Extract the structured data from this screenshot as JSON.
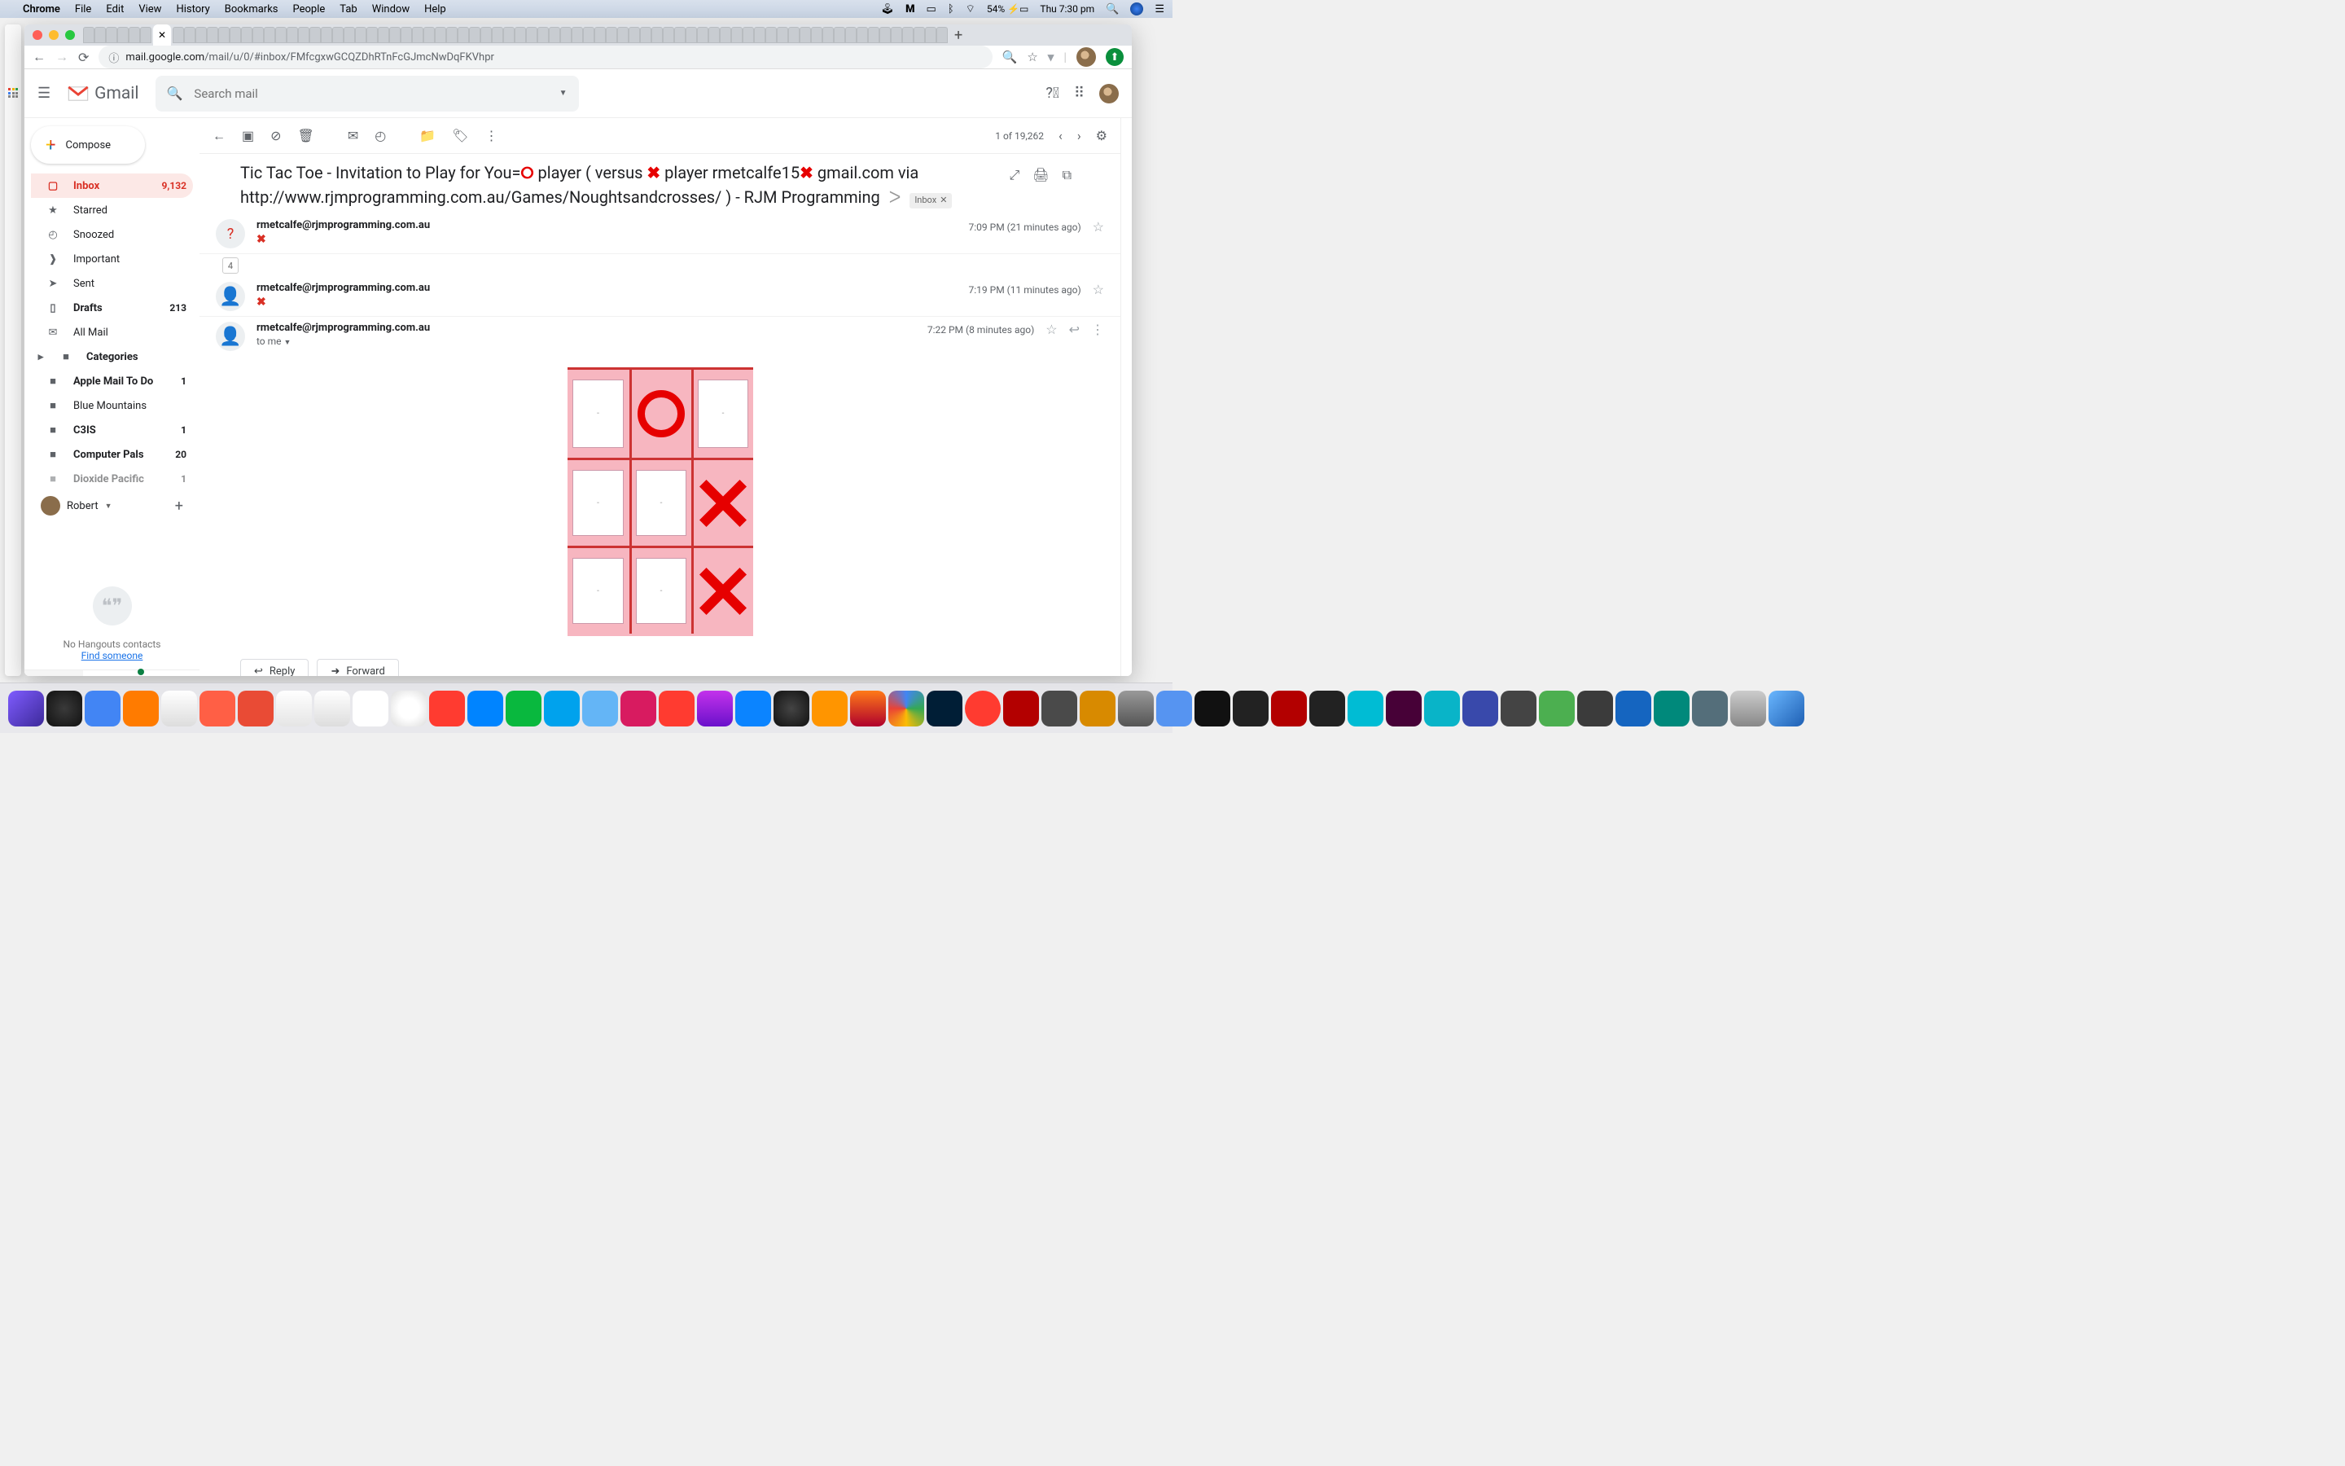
{
  "mac_menu": {
    "app": "Chrome",
    "items": [
      "File",
      "Edit",
      "View",
      "History",
      "Bookmarks",
      "People",
      "Tab",
      "Window",
      "Help"
    ],
    "battery": "54%",
    "clock": "Thu 7:30 pm"
  },
  "chrome": {
    "url_prefix": "mail.google.com",
    "url_rest": "/mail/u/0/#inbox/FMfcgxwGCQZDhRTnFcGJmcNwDqFKVhpr"
  },
  "gmail": {
    "brand": "Gmail",
    "search_placeholder": "Search mail",
    "compose": "Compose",
    "nav": [
      {
        "icon": "inbox",
        "label": "Inbox",
        "count": "9,132",
        "active": true
      },
      {
        "icon": "star",
        "label": "Starred"
      },
      {
        "icon": "clock",
        "label": "Snoozed"
      },
      {
        "icon": "important",
        "label": "Important"
      },
      {
        "icon": "send",
        "label": "Sent"
      },
      {
        "icon": "file",
        "label": "Drafts",
        "count": "213",
        "bold": true
      },
      {
        "icon": "mail",
        "label": "All Mail"
      },
      {
        "icon": "tag",
        "label": "Categories",
        "bold": true,
        "expand": true
      },
      {
        "icon": "tag",
        "label": "Apple Mail To Do",
        "count": "1",
        "bold": true
      },
      {
        "icon": "tag",
        "label": "Blue Mountains"
      },
      {
        "icon": "tag",
        "label": "C3IS",
        "count": "1",
        "bold": true
      },
      {
        "icon": "tag",
        "label": "Computer Pals",
        "count": "20",
        "bold": true
      },
      {
        "icon": "tag",
        "label": "Dioxide Pacific",
        "count": "1",
        "bold": true
      }
    ],
    "user_name": "Robert",
    "hangouts_empty": "No Hangouts contacts",
    "hangouts_link": "Find someone",
    "count_text": "1 of 19,262",
    "subject_1": "Tic Tac Toe - Invitation to Play for You=",
    "subject_2": "  player ( versus ",
    "subject_3": " player rmetcalfe15",
    "subject_4": " gmail.com via http://www.rjmprogramming.com.au/Games/Noughtsandcrosses/ ) - RJM Programming",
    "inbox_chip": "Inbox",
    "messages": [
      {
        "from": "rmetcalfe@rjmprogramming.com.au",
        "time": "7:09 PM (21 minutes ago)",
        "preview": "✖",
        "avatar": "?"
      },
      {
        "from": "rmetcalfe@rjmprogramming.com.au",
        "time": "7:19 PM (11 minutes ago)",
        "preview": "✖",
        "avatar": "person"
      },
      {
        "from": "rmetcalfe@rjmprogramming.com.au",
        "time": "7:22 PM (8 minutes ago)",
        "to": "to me",
        "avatar": "person"
      }
    ],
    "thread_count_badge": "4",
    "reply": "Reply",
    "forward": "Forward",
    "board": [
      [
        "",
        "O",
        ""
      ],
      [
        "",
        "",
        "X"
      ],
      [
        "",
        "",
        "X"
      ]
    ]
  }
}
